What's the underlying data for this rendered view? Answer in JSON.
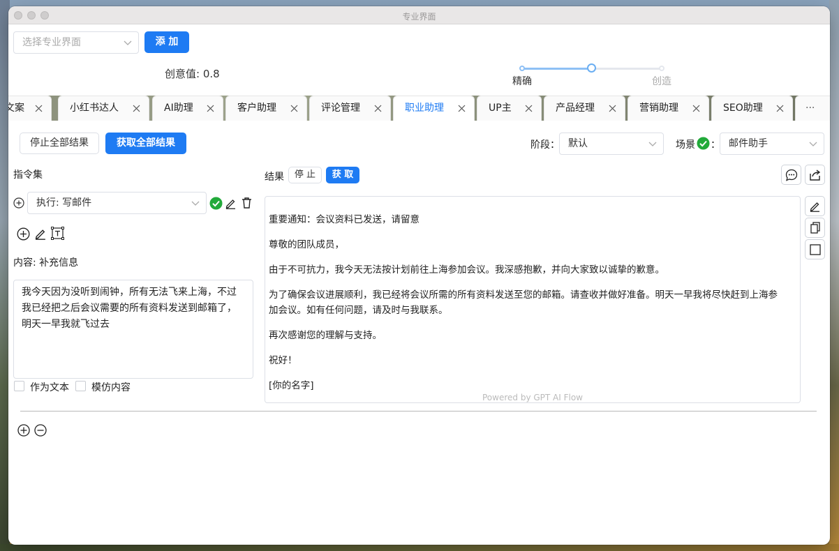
{
  "window": {
    "title": "专业界面"
  },
  "top": {
    "select_placeholder": "选择专业界面",
    "add_button": "添 加",
    "creativity_label": "创意值: 0.8",
    "slider": {
      "left_label": "精确",
      "right_label": "创造",
      "value": 0.8
    }
  },
  "tabs": [
    {
      "label": "文案"
    },
    {
      "label": "小红书达人"
    },
    {
      "label": "AI助理"
    },
    {
      "label": "客户助理"
    },
    {
      "label": "评论管理"
    },
    {
      "label": "职业助理",
      "active": true
    },
    {
      "label": "UP主"
    },
    {
      "label": "产品经理"
    },
    {
      "label": "营销助理"
    },
    {
      "label": "SEO助理"
    }
  ],
  "tabs_more": "···",
  "toolbar": {
    "stop_all": "停止全部结果",
    "get_all": "获取全部结果",
    "stage_label": "阶段：",
    "stage_value": "默认",
    "scene_label": "场景",
    "scene_colon": "：",
    "scene_value": "邮件助手"
  },
  "left": {
    "instruction_set": "指令集",
    "exec_select": "执行: 写邮件",
    "content_label": "内容: 补充信息",
    "textarea_value": "我今天因为没听到闹钟，所有无法飞来上海，不过我已经把之后会议需要的所有资料发送到邮箱了，明天一早我就飞过去",
    "as_text": "作为文本",
    "imitate": "模仿内容"
  },
  "result": {
    "label": "结果",
    "stop": "停 止",
    "get": "获 取",
    "lines": [
      "重要通知：会议资料已发送，请留意",
      "尊敬的团队成员，",
      "由于不可抗力，我今天无法按计划前往上海参加会议。我深感抱歉，并向大家致以诚挚的歉意。",
      "为了确保会议进展顺利，我已经将会议所需的所有资料发送至您的邮箱。请查收并做好准备。明天一早我将尽快赶到上海参",
      "加会议。如有任何问题，请及时与我联系。",
      "再次感谢您的理解与支持。",
      "祝好！",
      "[你的名字]"
    ],
    "powered_by": "Powered by GPT AI Flow"
  },
  "colors": {
    "primary": "#1e7bf3",
    "success": "#22aa3a"
  }
}
